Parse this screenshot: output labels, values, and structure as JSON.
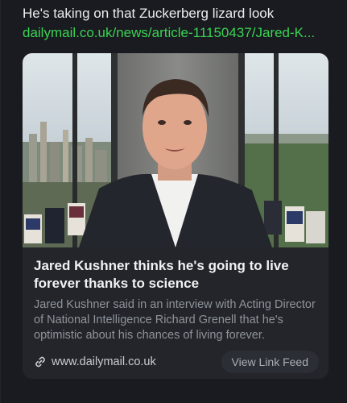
{
  "post": {
    "text": "He's taking on that Zuckerberg lizard look",
    "link_text": "dailymail.co.uk/news/article-11150437/Jared-K..."
  },
  "card": {
    "image_icon": "video-still-thumbnail",
    "title": "Jared Kushner thinks he's going to live forever thanks to science",
    "description": "Jared Kushner said in an interview with Acting Director of National Intelligence Richard Grenell that he's optimistic about his chances of living forever.",
    "domain": "www.dailymail.co.uk",
    "domain_icon": "link-icon",
    "view_button": "View Link Feed"
  },
  "colors": {
    "background": "#1a1b20",
    "card": "#23252b",
    "link": "#39d353"
  }
}
